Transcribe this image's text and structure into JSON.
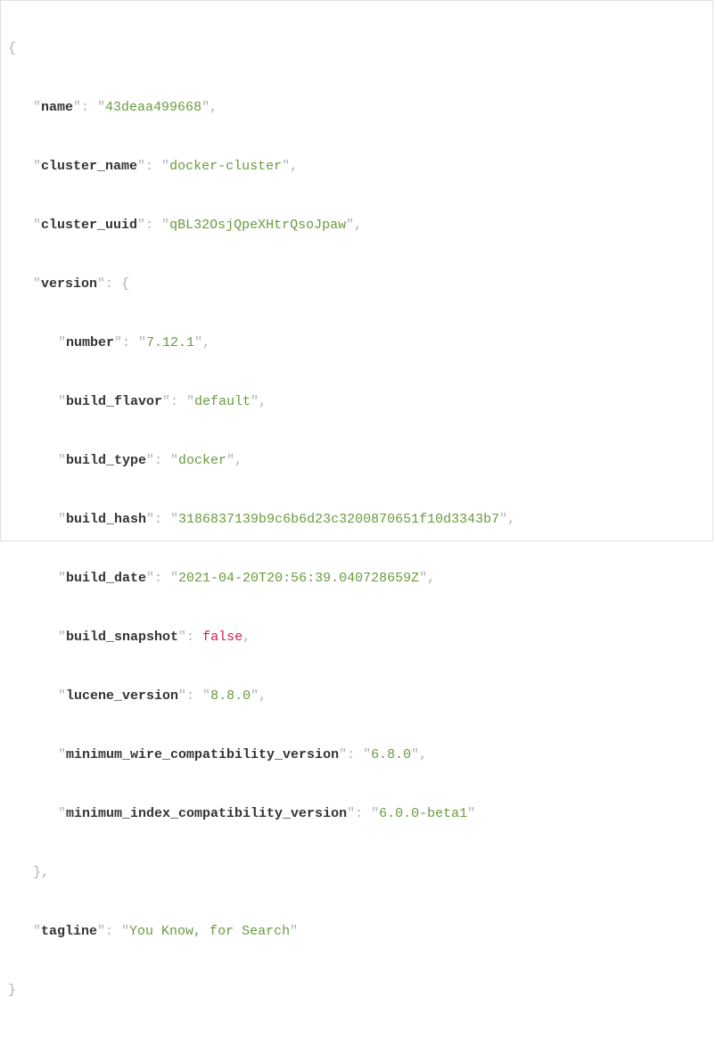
{
  "keys": {
    "name": "name",
    "cluster_name": "cluster_name",
    "cluster_uuid": "cluster_uuid",
    "version": "version",
    "number": "number",
    "build_flavor": "build_flavor",
    "build_type": "build_type",
    "build_hash": "build_hash",
    "build_date": "build_date",
    "build_snapshot": "build_snapshot",
    "lucene_version": "lucene_version",
    "minimum_wire_compatibility_version": "minimum_wire_compatibility_version",
    "minimum_index_compatibility_version": "minimum_index_compatibility_version",
    "tagline": "tagline"
  },
  "values": {
    "name": "43deaa499668",
    "cluster_name": "docker-cluster",
    "cluster_uuid": "qBL32OsjQpeXHtrQsoJpaw",
    "number": "7.12.1",
    "build_flavor": "default",
    "build_type": "docker",
    "build_hash": "3186837139b9c6b6d23c3200870651f10d3343b7",
    "build_date": "2021-04-20T20:56:39.040728659Z",
    "build_snapshot": "false",
    "lucene_version": "8.8.0",
    "minimum_wire_compatibility_version": "6.8.0",
    "minimum_index_compatibility_version": "6.0.0-beta1",
    "tagline": "You Know, for Search"
  }
}
